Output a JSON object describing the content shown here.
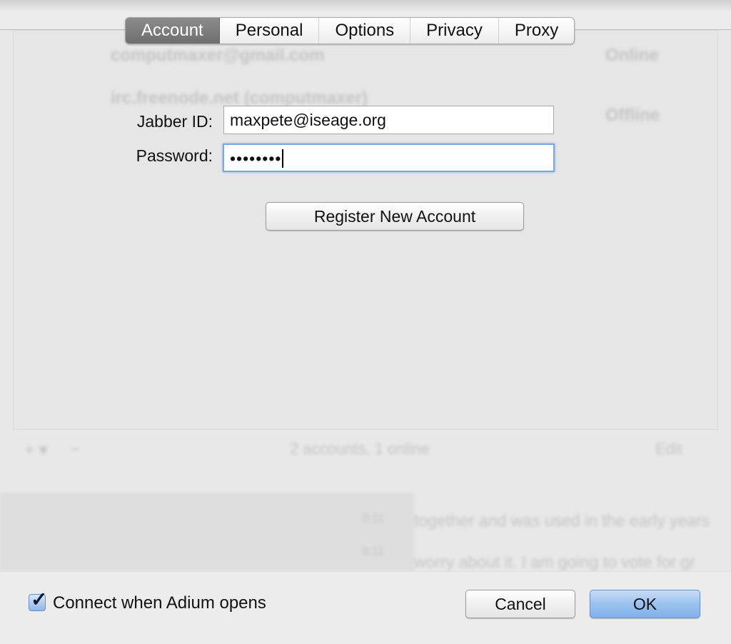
{
  "tabs": [
    {
      "label": "Account",
      "active": true
    },
    {
      "label": "Personal"
    },
    {
      "label": "Options"
    },
    {
      "label": "Privacy"
    },
    {
      "label": "Proxy"
    }
  ],
  "form": {
    "jabber_label": "Jabber ID:",
    "jabber_value": "maxpete@iseage.org",
    "password_label": "Password:",
    "password_value": "••••••••",
    "register_label": "Register New Account"
  },
  "background": {
    "account1": "computmaxer@gmail.com",
    "account1_status": "Online",
    "account2": "irc.freenode.net (computmaxer)",
    "account2_status": "Offline",
    "summary": "2 accounts, 1 online",
    "edit": "Edit",
    "add": "+ ▾",
    "remove": "−",
    "chat1": "together and was used in the early years",
    "chat2": "worry about it.  I am going to vote for gr",
    "time1": "0:11",
    "time2": "0:11"
  },
  "footer": {
    "connect_label": "Connect when Adium opens",
    "connect_checked": true,
    "cancel_label": "Cancel",
    "ok_label": "OK"
  }
}
